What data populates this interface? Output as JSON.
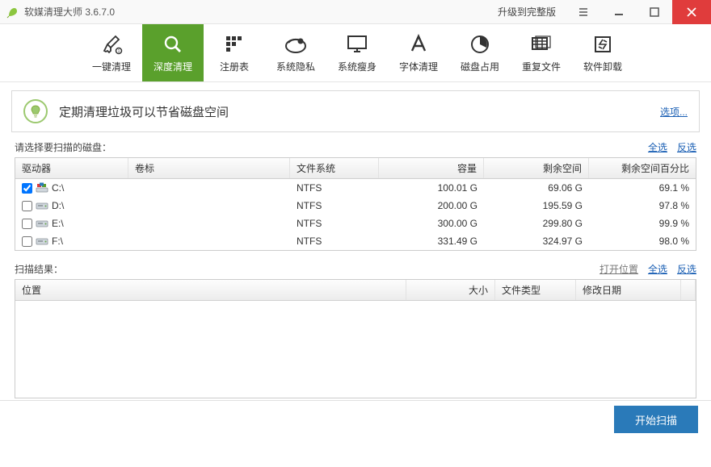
{
  "window": {
    "title": "软媒清理大师 3.6.7.0",
    "upgrade": "升级到完整版"
  },
  "toolbar": {
    "items": [
      {
        "label": "一键清理"
      },
      {
        "label": "深度清理"
      },
      {
        "label": "注册表"
      },
      {
        "label": "系统隐私"
      },
      {
        "label": "系统瘦身"
      },
      {
        "label": "字体清理"
      },
      {
        "label": "磁盘占用"
      },
      {
        "label": "重复文件"
      },
      {
        "label": "软件卸载"
      }
    ],
    "active_index": 1
  },
  "banner": {
    "text": "定期清理垃圾可以节省磁盘空间",
    "options": "选项..."
  },
  "disks_section": {
    "title": "请选择要扫描的磁盘：",
    "select_all": "全选",
    "deselect": "反选",
    "headers": {
      "drive": "驱动器",
      "label": "卷标",
      "fs": "文件系统",
      "capacity": "容量",
      "free": "剩余空间",
      "pct": "剩余空间百分比"
    },
    "rows": [
      {
        "checked": true,
        "drive": "C:\\",
        "label": "",
        "fs": "NTFS",
        "capacity": "100.01 G",
        "free": "69.06 G",
        "pct": "69.1 %"
      },
      {
        "checked": false,
        "drive": "D:\\",
        "label": "",
        "fs": "NTFS",
        "capacity": "200.00 G",
        "free": "195.59 G",
        "pct": "97.8 %"
      },
      {
        "checked": false,
        "drive": "E:\\",
        "label": "",
        "fs": "NTFS",
        "capacity": "300.00 G",
        "free": "299.80 G",
        "pct": "99.9 %"
      },
      {
        "checked": false,
        "drive": "F:\\",
        "label": "",
        "fs": "NTFS",
        "capacity": "331.49 G",
        "free": "324.97 G",
        "pct": "98.0 %"
      }
    ]
  },
  "results_section": {
    "title": "扫描结果：",
    "open_location": "打开位置",
    "select_all": "全选",
    "deselect": "反选",
    "headers": {
      "location": "位置",
      "size": "大小",
      "type": "文件类型",
      "date": "修改日期"
    }
  },
  "scan_button": "开始扫描"
}
